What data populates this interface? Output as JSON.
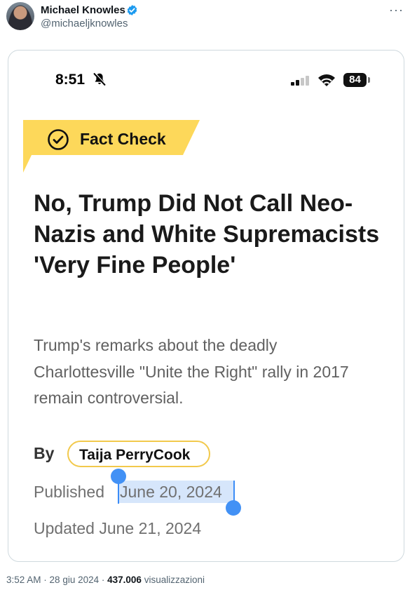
{
  "author": {
    "name": "Michael Knowles",
    "handle": "@michaeljknowles"
  },
  "phone_status": {
    "time": "8:51",
    "battery": "84"
  },
  "article": {
    "badge": "Fact Check",
    "headline": "No, Trump Did Not Call Neo-Nazis and White Supremacists 'Very Fine People'",
    "subheadline": "Trump's remarks about the deadly Charlottesville \"Unite the Right\" rally in 2017 remain controversial.",
    "by_label": "By",
    "author_name": "Taija PerryCook",
    "published_label": "Published",
    "published_date": "June 20, 2024",
    "updated": "Updated June 21, 2024"
  },
  "tweet_meta": {
    "time": "3:52 AM",
    "date": "28 giu 2024",
    "views_count": "437.006",
    "views_label": "visualizzazioni"
  },
  "colors": {
    "banner": "#fdd85a",
    "verified": "#1d9bf0",
    "selection": "#d6e6fb",
    "selection_handle": "#4291f5"
  }
}
